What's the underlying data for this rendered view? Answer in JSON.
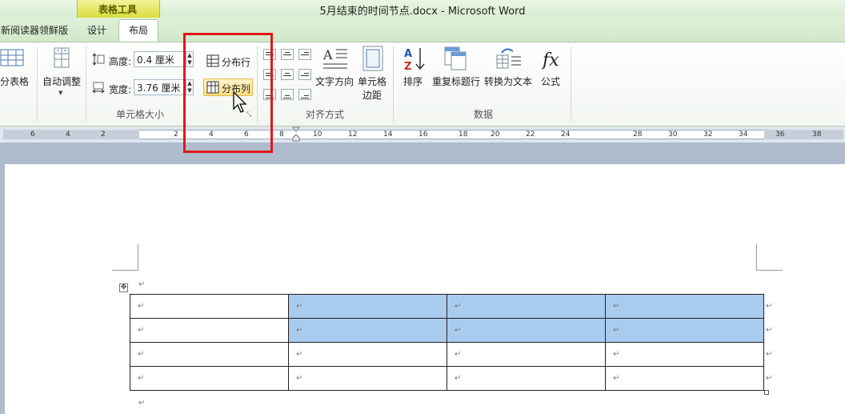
{
  "window": {
    "title": "5月结束的时间节点.docx - Microsoft Word"
  },
  "context_tab_group": {
    "label": "表格工具"
  },
  "tabs": [
    {
      "label": "新阅读器领鲜版"
    },
    {
      "label": "设计"
    },
    {
      "label": "布局",
      "active": true
    }
  ],
  "ribbon": {
    "split_table_label": "拆分表格",
    "autofit_label": "自动调整",
    "height_label": "高度:",
    "height_value": "0.4 厘米",
    "width_label": "宽度:",
    "width_value": "3.76 厘米",
    "distribute_rows_label": "分布行",
    "distribute_cols_label": "分布列",
    "cell_size_group": "单元格大小",
    "text_direction_label": "文字方向",
    "cell_margins_label_1": "单元格",
    "cell_margins_label_2": "边距",
    "alignment_group": "对齐方式",
    "sort_label": "排序",
    "repeat_header_label": "重复标题行",
    "convert_to_text_label": "转换为文本",
    "formula_label": "公式",
    "data_group": "数据"
  },
  "ruler": {
    "left_ticks": [
      "6",
      "4",
      "2"
    ],
    "ticks": [
      "2",
      "4",
      "6",
      "8",
      "10",
      "12",
      "14",
      "16",
      "18",
      "20",
      "22",
      "24",
      "28",
      "30",
      "32",
      "34",
      "36",
      "38"
    ]
  },
  "document": {
    "paragraph_mark": "↵",
    "table_rows": [
      [
        {
          "text": "↵",
          "selected": false
        },
        {
          "text": "↵",
          "selected": true
        },
        {
          "text": "↵",
          "selected": true
        },
        {
          "text": "↵",
          "selected": true
        }
      ],
      [
        {
          "text": "↵",
          "selected": false
        },
        {
          "text": "↵",
          "selected": true
        },
        {
          "text": "↵",
          "selected": true
        },
        {
          "text": "↵",
          "selected": true
        }
      ],
      [
        {
          "text": "↵",
          "selected": false
        },
        {
          "text": "↵",
          "selected": false
        },
        {
          "text": "↵",
          "selected": false
        },
        {
          "text": "↵",
          "selected": false
        }
      ],
      [
        {
          "text": "↵",
          "selected": false
        },
        {
          "text": "↵",
          "selected": false
        },
        {
          "text": "↵",
          "selected": false
        },
        {
          "text": "↵",
          "selected": false
        }
      ]
    ]
  },
  "colors": {
    "highlight_box": "#e21818",
    "selection": "#a9cbee",
    "context_tab": "#d9dd3a"
  }
}
